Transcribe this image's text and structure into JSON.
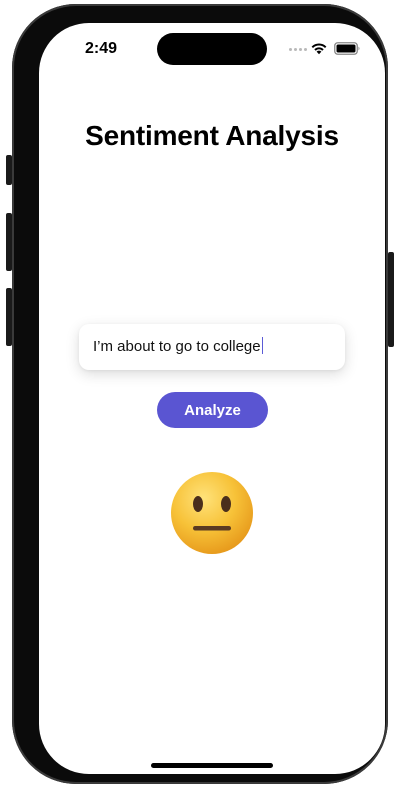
{
  "status_bar": {
    "time": "2:49",
    "icons": [
      "signal-dots-icon",
      "wifi-icon",
      "battery-icon"
    ]
  },
  "app": {
    "title": "Sentiment Analysis",
    "input": {
      "value": "I’m about to go to college"
    },
    "analyze_button_label": "Analyze",
    "result": {
      "sentiment": "neutral",
      "emoji_icon": "neutral-face-emoji-icon"
    }
  },
  "colors": {
    "accent": "#5a55d2",
    "emoji_face": "#f7c238",
    "background": "#ffffff"
  }
}
